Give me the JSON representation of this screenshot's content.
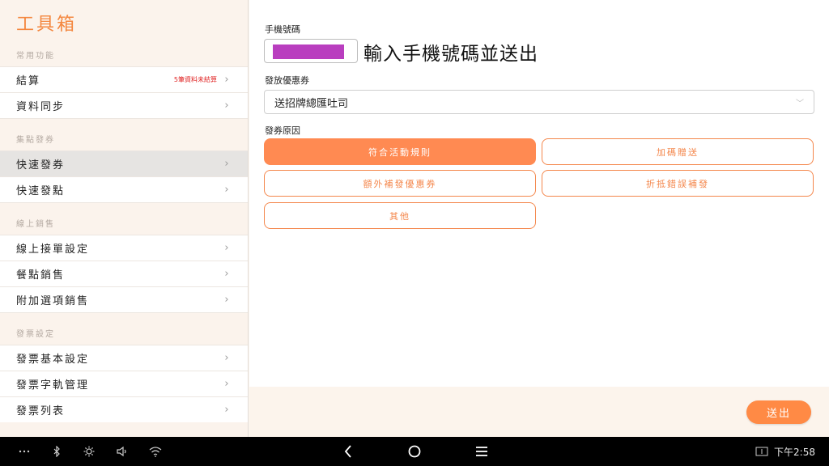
{
  "sidebar": {
    "title": "工具箱",
    "sections": [
      {
        "title": "常用功能",
        "items": [
          {
            "label": "結算",
            "badge": "5筆資料未結算"
          },
          {
            "label": "資料同步",
            "badge": ""
          }
        ]
      },
      {
        "title": "集點發券",
        "items": [
          {
            "label": "快速發券",
            "badge": "",
            "selected": true
          },
          {
            "label": "快速發點",
            "badge": ""
          }
        ]
      },
      {
        "title": "線上銷售",
        "items": [
          {
            "label": "線上接單設定",
            "badge": ""
          },
          {
            "label": "餐點銷售",
            "badge": ""
          },
          {
            "label": "附加選項銷售",
            "badge": ""
          }
        ]
      },
      {
        "title": "發票設定",
        "items": [
          {
            "label": "發票基本設定",
            "badge": ""
          },
          {
            "label": "發票字軌管理",
            "badge": ""
          },
          {
            "label": "發票列表",
            "badge": ""
          }
        ]
      }
    ]
  },
  "form": {
    "phone_label": "手機號碼",
    "phone_hint": "輸入手機號碼並送出",
    "coupon_label": "發放優惠券",
    "coupon_value": "送招牌總匯吐司",
    "reason_label": "發券原因",
    "reasons": [
      {
        "label": "符合活動規則",
        "active": true
      },
      {
        "label": "加碼贈送",
        "active": false
      },
      {
        "label": "額外補發優惠券",
        "active": false
      },
      {
        "label": "折抵錯誤補發",
        "active": false
      },
      {
        "label": "其他",
        "active": false
      }
    ],
    "send_label": "送出"
  },
  "status_bar": {
    "time": "下午2:58",
    "icons": [
      "more-icon",
      "bluetooth-icon",
      "brightness-icon",
      "volume-icon",
      "wifi-icon",
      "back-icon",
      "home-icon",
      "recents-icon",
      "screenshot-icon"
    ]
  },
  "colors": {
    "accent": "#ff8a52",
    "title": "#f4873f",
    "badge": "#e02424",
    "redaction": "#b93ebf"
  }
}
